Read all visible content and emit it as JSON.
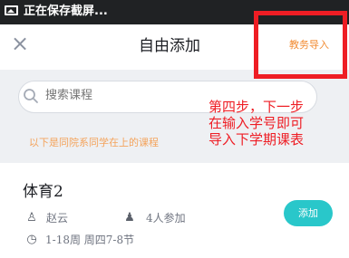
{
  "status_bar": {
    "icon": "image-icon",
    "text": "正在保存截屏..."
  },
  "header": {
    "close_icon": "×",
    "title": "自由添加",
    "action_label": "教务导入"
  },
  "search": {
    "placeholder": "搜索课程"
  },
  "hint": {
    "text": "以下是同院系同学在上的课程"
  },
  "annotation": {
    "text": "第四步，下一步\n在输入学号即可\n导入下学期课表"
  },
  "course": {
    "name": "体育2",
    "teacher": "赵云",
    "participants": "4人参加",
    "schedule": "1-18周 周四7-8节",
    "add_label": "添加"
  },
  "colors": {
    "annotation_red": "#ee1d24",
    "accent_orange": "#f28c33",
    "button_teal": "#29c7ca"
  }
}
